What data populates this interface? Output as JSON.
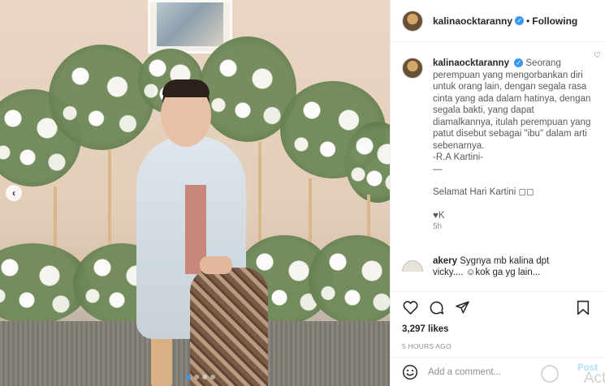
{
  "post": {
    "username": "kalinaocktaranny",
    "separator": "•",
    "follow_state": "Following",
    "verified_glyph": "✓",
    "caption_lines": [
      "Seorang",
      "perempuan yang mengorbankan diri",
      "untuk orang lain, dengan segala rasa",
      "cinta yang ada dalam hatinya, dengan",
      "segala bakti, yang dapat",
      "diamalkannya, itulah perempuan yang",
      "patut disebut sebagai \"ibu\" dalam arti",
      "sebenarnya.",
      "-R.A Kartini-",
      "—"
    ],
    "caption_greeting": "Selamat Hari Kartini ◻◻",
    "caption_sign": "♥K",
    "caption_age": "5h",
    "likes": "3,297 likes",
    "posted_ago": "5 HOURS AGO"
  },
  "comment": {
    "username": "akery",
    "text": "Sygnya mb kalina dpt vicky.... ☺kok ga yg lain...",
    "heart_glyph": "♡"
  },
  "carousel": {
    "prev_glyph": "‹",
    "dot_count": 4,
    "active_index": 0
  },
  "add_comment": {
    "placeholder": "Add a comment...",
    "post_label": "Post"
  },
  "overlay": {
    "activate_text": "Activ"
  },
  "icons": [
    "heart-icon",
    "comment-icon",
    "share-icon",
    "bookmark-icon",
    "emoji-icon",
    "verified-badge-icon",
    "chevron-left-icon"
  ],
  "colors": {
    "accent": "#3897f0",
    "post_button": "#b2dffc",
    "muted_text": "#8e8e8e"
  }
}
